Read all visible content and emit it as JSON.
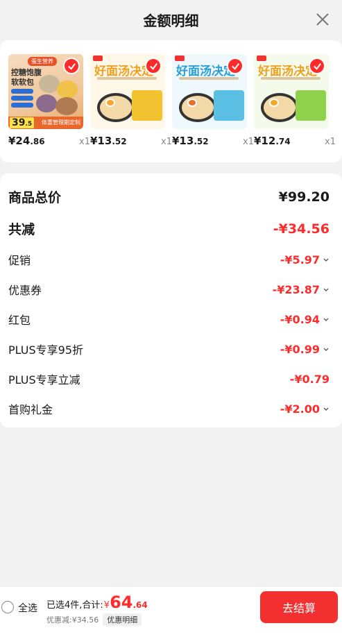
{
  "header": {
    "title": "金额明细"
  },
  "products": [
    {
      "price_int": "¥24",
      "price_dec": ".86",
      "qty": "x1",
      "thumb": {
        "tag": "蛋生营养",
        "headline": "控糖饱腹软软包",
        "number_int": "39",
        "number_dec": ".5",
        "banner": "体重管理期定制"
      }
    },
    {
      "price_int": "¥13",
      "price_dec": ".52",
      "qty": "x1",
      "thumb": {
        "headline": "好面汤决定",
        "pack_color": "#f2c230",
        "headline_color": "#f0a020"
      }
    },
    {
      "price_int": "¥13",
      "price_dec": ".52",
      "qty": "x1",
      "thumb": {
        "headline": "好面汤决定",
        "pack_color": "#5bbfe3",
        "headline_color": "#2a9fd8"
      }
    },
    {
      "price_int": "¥12",
      "price_dec": ".74",
      "qty": "x1",
      "thumb": {
        "headline": "好面汤决定",
        "pack_color": "#8fd14a",
        "headline_color": "#f0a020"
      }
    }
  ],
  "details": {
    "total_label": "商品总价",
    "total_value": "¥99.20",
    "reduce_label": "共减",
    "reduce_value": "-¥34.56",
    "items": [
      {
        "label": "促销",
        "value": "-¥5.97",
        "chevron": true
      },
      {
        "label": "优惠券",
        "value": "-¥23.87",
        "chevron": true
      },
      {
        "label": "红包",
        "value": "-¥0.94",
        "chevron": true
      },
      {
        "label": "PLUS专享95折",
        "value": "-¥0.99",
        "chevron": true
      },
      {
        "label": "PLUS专享立减",
        "value": "-¥0.79",
        "chevron": false
      },
      {
        "label": "首购礼金",
        "value": "-¥2.00",
        "chevron": true
      }
    ]
  },
  "bottom": {
    "select_all": "全选",
    "selected_text": "已选4件,合计:",
    "yen": "¥",
    "total_int": "64",
    "total_dec": ".64",
    "discount_text": "优惠减:¥34.56",
    "detail_pill": "优惠明细",
    "checkout": "去结算"
  },
  "colors": {
    "accent": "#ff2b2b",
    "checkout": "#f23030"
  }
}
